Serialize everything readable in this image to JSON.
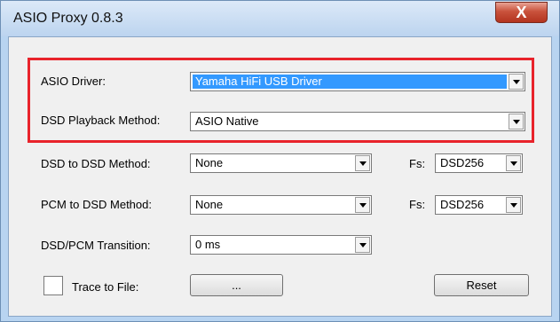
{
  "window": {
    "title": "ASIO Proxy 0.8.3",
    "close_label": "X"
  },
  "form": {
    "asio_driver": {
      "label": "ASIO Driver:",
      "value": "Yamaha HiFi USB Driver"
    },
    "dsd_playback": {
      "label": "DSD Playback Method:",
      "value": "ASIO Native"
    },
    "dsd_to_dsd": {
      "label": "DSD to DSD Method:",
      "value": "None",
      "fs_label": "Fs:",
      "fs_value": "DSD256"
    },
    "pcm_to_dsd": {
      "label": "PCM to DSD Method:",
      "value": "None",
      "fs_label": "Fs:",
      "fs_value": "DSD256"
    },
    "transition": {
      "label": "DSD/PCM Transition:",
      "value": "0 ms"
    },
    "trace": {
      "label": "Trace to File:",
      "browse_label": "...",
      "checked": false
    },
    "reset_label": "Reset"
  }
}
